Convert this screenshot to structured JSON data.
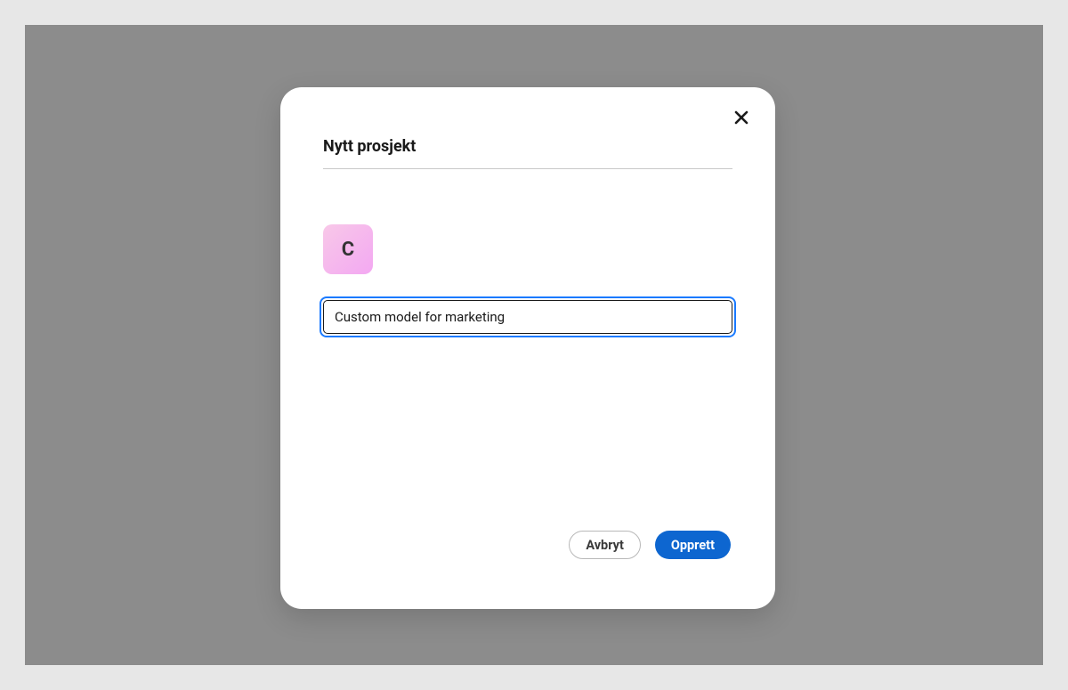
{
  "modal": {
    "title": "Nytt prosjekt",
    "icon_letter": "C",
    "name_input": {
      "value": "Custom model for marketing",
      "placeholder": ""
    },
    "footer": {
      "cancel_label": "Avbryt",
      "create_label": "Opprett"
    }
  },
  "colors": {
    "primary": "#0d66d0",
    "focus_ring": "#1a7aff",
    "backdrop": "#8c8c8c",
    "page_bg": "#e7e7e7"
  }
}
